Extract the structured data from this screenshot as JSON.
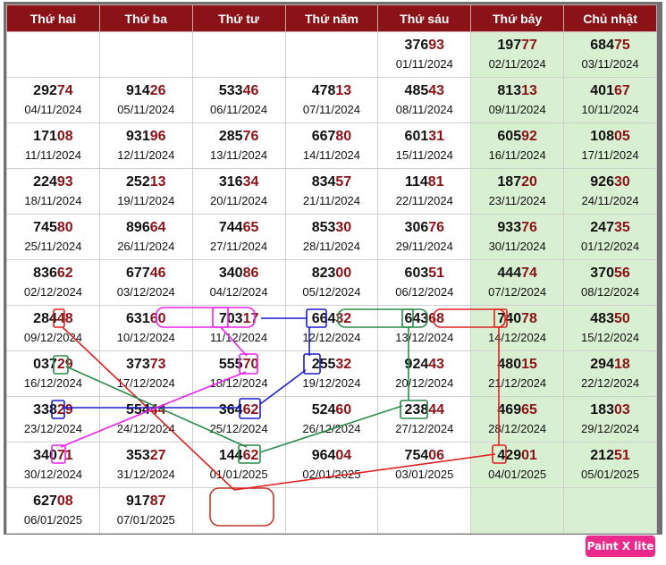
{
  "headers": [
    "Thứ hai",
    "Thứ ba",
    "Thứ tư",
    "Thứ năm",
    "Thứ sáu",
    "Thứ bảy",
    "Chủ nhật"
  ],
  "rows": [
    [
      null,
      null,
      null,
      null,
      {
        "head": "376",
        "tail": "93",
        "date": "01/11/2024"
      },
      {
        "head": "197",
        "tail": "77",
        "date": "02/11/2024"
      },
      {
        "head": "684",
        "tail": "75",
        "date": "03/11/2024"
      }
    ],
    [
      {
        "head": "292",
        "tail": "74",
        "date": "04/11/2024"
      },
      {
        "head": "914",
        "tail": "26",
        "date": "05/11/2024"
      },
      {
        "head": "533",
        "tail": "46",
        "date": "06/11/2024"
      },
      {
        "head": "478",
        "tail": "13",
        "date": "07/11/2024"
      },
      {
        "head": "485",
        "tail": "43",
        "date": "08/11/2024"
      },
      {
        "head": "813",
        "tail": "13",
        "date": "09/11/2024"
      },
      {
        "head": "401",
        "tail": "67",
        "date": "10/11/2024"
      }
    ],
    [
      {
        "head": "171",
        "tail": "08",
        "date": "11/11/2024"
      },
      {
        "head": "931",
        "tail": "96",
        "date": "12/11/2024"
      },
      {
        "head": "285",
        "tail": "76",
        "date": "13/11/2024"
      },
      {
        "head": "667",
        "tail": "80",
        "date": "14/11/2024"
      },
      {
        "head": "601",
        "tail": "31",
        "date": "15/11/2024"
      },
      {
        "head": "605",
        "tail": "92",
        "date": "16/11/2024"
      },
      {
        "head": "108",
        "tail": "05",
        "date": "17/11/2024"
      }
    ],
    [
      {
        "head": "224",
        "tail": "93",
        "date": "18/11/2024"
      },
      {
        "head": "252",
        "tail": "13",
        "date": "19/11/2024"
      },
      {
        "head": "316",
        "tail": "34",
        "date": "20/11/2024"
      },
      {
        "head": "834",
        "tail": "57",
        "date": "21/11/2024"
      },
      {
        "head": "114",
        "tail": "81",
        "date": "22/11/2024"
      },
      {
        "head": "187",
        "tail": "20",
        "date": "23/11/2024"
      },
      {
        "head": "926",
        "tail": "30",
        "date": "24/11/2024"
      }
    ],
    [
      {
        "head": "745",
        "tail": "80",
        "date": "25/11/2024"
      },
      {
        "head": "896",
        "tail": "64",
        "date": "26/11/2024"
      },
      {
        "head": "744",
        "tail": "65",
        "date": "27/11/2024"
      },
      {
        "head": "853",
        "tail": "30",
        "date": "28/11/2024"
      },
      {
        "head": "306",
        "tail": "76",
        "date": "29/11/2024"
      },
      {
        "head": "933",
        "tail": "76",
        "date": "30/11/2024"
      },
      {
        "head": "247",
        "tail": "35",
        "date": "01/12/2024"
      }
    ],
    [
      {
        "head": "836",
        "tail": "62",
        "date": "02/12/2024"
      },
      {
        "head": "677",
        "tail": "46",
        "date": "03/12/2024"
      },
      {
        "head": "340",
        "tail": "86",
        "date": "04/12/2024"
      },
      {
        "head": "823",
        "tail": "00",
        "date": "05/12/2024"
      },
      {
        "head": "603",
        "tail": "51",
        "date": "06/12/2024"
      },
      {
        "head": "444",
        "tail": "74",
        "date": "07/12/2024"
      },
      {
        "head": "370",
        "tail": "56",
        "date": "08/12/2024"
      }
    ],
    [
      {
        "head": "284",
        "tail": "48",
        "date": "09/12/2024"
      },
      {
        "head": "631",
        "tail": "60",
        "date": "10/12/2024"
      },
      {
        "head": "703",
        "tail": "17",
        "date": "11/12/2024"
      },
      {
        "head": "664",
        "tail": "32",
        "date": "12/12/2024"
      },
      {
        "head": "643",
        "tail": "68",
        "date": "13/12/2024"
      },
      {
        "head": "740",
        "tail": "78",
        "date": "14/12/2024"
      },
      {
        "head": "483",
        "tail": "50",
        "date": "15/12/2024"
      }
    ],
    [
      {
        "head": "037",
        "tail": "29",
        "date": "16/12/2024"
      },
      {
        "head": "373",
        "tail": "73",
        "date": "17/12/2024"
      },
      {
        "head": "555",
        "tail": "70",
        "date": "18/12/2024"
      },
      {
        "head": "255",
        "tail": "32",
        "date": "19/12/2024"
      },
      {
        "head": "924",
        "tail": "43",
        "date": "20/12/2024"
      },
      {
        "head": "480",
        "tail": "15",
        "date": "21/12/2024"
      },
      {
        "head": "294",
        "tail": "18",
        "date": "22/12/2024"
      }
    ],
    [
      {
        "head": "338",
        "tail": "29",
        "date": "23/12/2024"
      },
      {
        "head": "554",
        "tail": "44",
        "date": "24/12/2024"
      },
      {
        "head": "364",
        "tail": "62",
        "date": "25/12/2024"
      },
      {
        "head": "524",
        "tail": "60",
        "date": "26/12/2024"
      },
      {
        "head": "238",
        "tail": "44",
        "date": "27/12/2024"
      },
      {
        "head": "469",
        "tail": "65",
        "date": "28/12/2024"
      },
      {
        "head": "183",
        "tail": "03",
        "date": "29/12/2024"
      }
    ],
    [
      {
        "head": "340",
        "tail": "71",
        "date": "30/12/2024"
      },
      {
        "head": "353",
        "tail": "27",
        "date": "31/12/2024"
      },
      {
        "head": "144",
        "tail": "62",
        "date": "01/01/2025"
      },
      {
        "head": "964",
        "tail": "04",
        "date": "02/01/2025"
      },
      {
        "head": "754",
        "tail": "06",
        "date": "03/01/2025"
      },
      {
        "head": "429",
        "tail": "01",
        "date": "04/01/2025"
      },
      {
        "head": "212",
        "tail": "51",
        "date": "05/01/2025"
      }
    ],
    [
      {
        "head": "627",
        "tail": "08",
        "date": "06/01/2025"
      },
      {
        "head": "917",
        "tail": "87",
        "date": "07/01/2025"
      },
      null,
      null,
      null,
      null,
      null
    ]
  ],
  "colors": {
    "header_bg": "#8b1217",
    "tail_digits": "#8b1217",
    "weekend_bg": "#d9efd1",
    "red_line": "#e02020",
    "green_line": "#2a8a4a",
    "blue_line": "#1a1ad0",
    "magenta_line": "#ee22ee"
  },
  "logo": {
    "label": "Paint X lite"
  }
}
